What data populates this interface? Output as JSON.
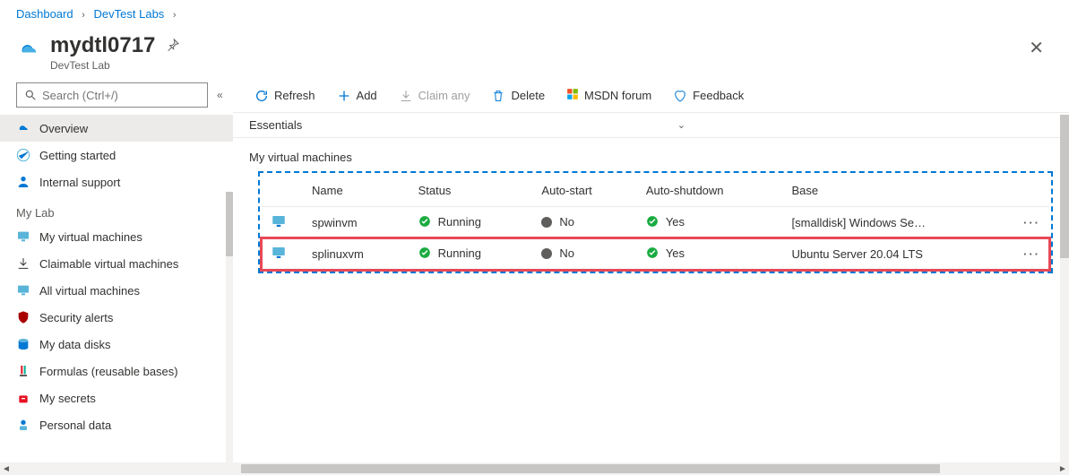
{
  "breadcrumb": {
    "items": [
      "Dashboard",
      "DevTest Labs"
    ]
  },
  "header": {
    "title": "mydtl0717",
    "subtitle": "DevTest Lab"
  },
  "search": {
    "placeholder": "Search (Ctrl+/)"
  },
  "sidebar": {
    "top": [
      {
        "label": "Overview",
        "icon": "overview"
      },
      {
        "label": "Getting started",
        "icon": "getting-started"
      },
      {
        "label": "Internal support",
        "icon": "support"
      }
    ],
    "heading": "My Lab",
    "lab": [
      {
        "label": "My virtual machines",
        "icon": "vm"
      },
      {
        "label": "Claimable virtual machines",
        "icon": "claimable"
      },
      {
        "label": "All virtual machines",
        "icon": "all-vm"
      },
      {
        "label": "Security alerts",
        "icon": "security"
      },
      {
        "label": "My data disks",
        "icon": "disk"
      },
      {
        "label": "Formulas (reusable bases)",
        "icon": "formula"
      },
      {
        "label": "My secrets",
        "icon": "secret"
      },
      {
        "label": "Personal data",
        "icon": "personal"
      }
    ]
  },
  "toolbar": {
    "refresh": "Refresh",
    "add": "Add",
    "claim": "Claim any",
    "delete": "Delete",
    "msdn": "MSDN forum",
    "feedback": "Feedback"
  },
  "essentials_label": "Essentials",
  "section_title": "My virtual machines",
  "columns": {
    "name": "Name",
    "status": "Status",
    "autostart": "Auto-start",
    "autoshutdown": "Auto-shutdown",
    "base": "Base"
  },
  "rows": [
    {
      "name": "spwinvm",
      "status": "Running",
      "autostart": "No",
      "autoshutdown": "Yes",
      "base": "[smalldisk] Windows Se…"
    },
    {
      "name": "splinuxvm",
      "status": "Running",
      "autostart": "No",
      "autoshutdown": "Yes",
      "base": "Ubuntu Server 20.04 LTS"
    }
  ]
}
